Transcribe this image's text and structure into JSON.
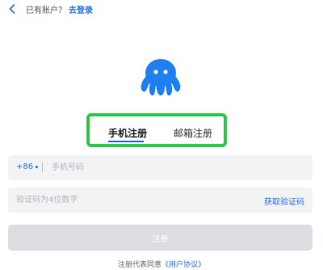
{
  "top_bar": {
    "have_account_text": "已有账户？",
    "login_link": "去登录"
  },
  "tabs": {
    "phone": "手机注册",
    "email": "邮箱注册",
    "active": "phone"
  },
  "phone_field": {
    "country_code": "+86",
    "placeholder": "手机号码"
  },
  "code_field": {
    "placeholder": "验证码为4位数字",
    "get_code_label": "获取验证码"
  },
  "register_button": {
    "label": "注册"
  },
  "agreement": {
    "prefix": "注册代表同意",
    "link": "《用户协议》"
  },
  "colors": {
    "accent": "#2a6fe0",
    "highlight_frame": "#2fc84a",
    "field_bg": "#f2f3f5",
    "button_disabled": "#dcdde1"
  },
  "icons": {
    "back": "chevron-left-icon",
    "logo": "octopus-logo-icon"
  }
}
